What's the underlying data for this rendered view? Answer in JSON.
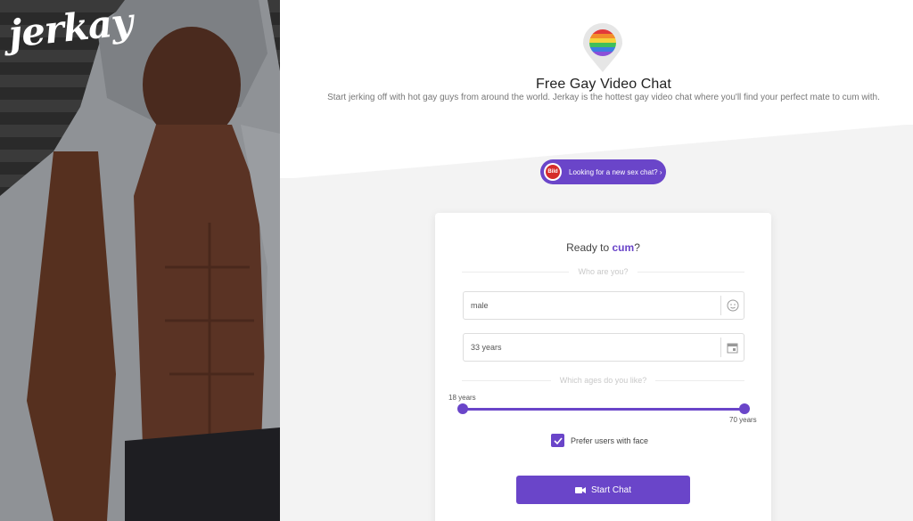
{
  "brand": {
    "logo_text": "jerkay"
  },
  "header": {
    "title": "Free Gay Video Chat",
    "description": "Start jerking off with hot gay guys from around the world. Jerkay is the hottest gay video chat where you'll find your perfect mate to cum with."
  },
  "promo": {
    "badge_text": "Bild",
    "label": "Looking for a new sex chat? ›"
  },
  "form": {
    "ready_prefix": "Ready to ",
    "ready_highlight": "cum",
    "ready_suffix": "?",
    "who_label": "Who are you?",
    "gender_value": "male",
    "age_value": "33 years",
    "ages_label": "Which ages do you like?",
    "age_range": {
      "min": 18,
      "max": 70,
      "min_label": "18 years",
      "max_label": "70 years",
      "selected_min": 18,
      "selected_max": 70
    },
    "face_checkbox": {
      "label": "Prefer users with face",
      "checked": true
    },
    "start_button": "Start Chat"
  },
  "colors": {
    "accent": "#6a45c9",
    "badge_red": "#d52b2b"
  },
  "icons": {
    "gender": "face-icon",
    "age": "calendar-icon",
    "start": "video-camera-icon",
    "marker": "rainbow-map-marker-icon"
  }
}
